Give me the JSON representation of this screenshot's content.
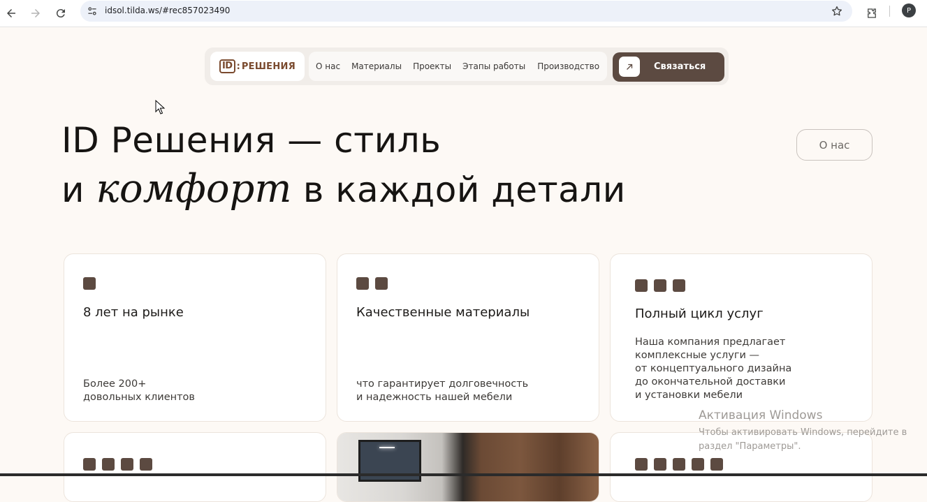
{
  "browser": {
    "url": "idsol.tilda.ws/#rec857023490",
    "profile_initial": "P"
  },
  "nav": {
    "logo_id": "ID",
    "logo_colon": ":",
    "logo_text": "РЕШЕНИЯ",
    "links": [
      "О нас",
      "Материалы",
      "Проекты",
      "Этапы работы",
      "Производство"
    ],
    "cta_label": "Связаться"
  },
  "hero": {
    "line1": "ID Решения — стиль",
    "line2_a": "и",
    "line2_italic": "комфорт",
    "line2_b": "в каждой детали",
    "about_button": "О нас"
  },
  "cards": [
    {
      "squares": 1,
      "title": "8 лет на рынке",
      "text": [
        "Более 200+",
        "довольных клиентов"
      ]
    },
    {
      "squares": 2,
      "title": "Качественные материалы",
      "text": [
        "что гарантирует долговечность",
        "и надежность нашей мебели"
      ]
    },
    {
      "squares": 3,
      "title": "Полный цикл услуг",
      "text": [
        "Наша компания предлагает",
        "комплексные услуги —",
        "от концептуального дизайна",
        "до окончательной доставки",
        "и установки мебели"
      ]
    }
  ],
  "cards_row2": [
    {
      "squares": 4
    },
    {
      "image": "interior-photo"
    },
    {
      "squares": 5
    }
  ],
  "watermark": {
    "title": "Активация Windows",
    "line1": "Чтобы активировать Windows, перейдите в",
    "line2": "раздел \"Параметры\"."
  },
  "colors": {
    "accent": "#5c4a41",
    "logo": "#7a4a2e",
    "page_bg": "#fdf9f5"
  }
}
